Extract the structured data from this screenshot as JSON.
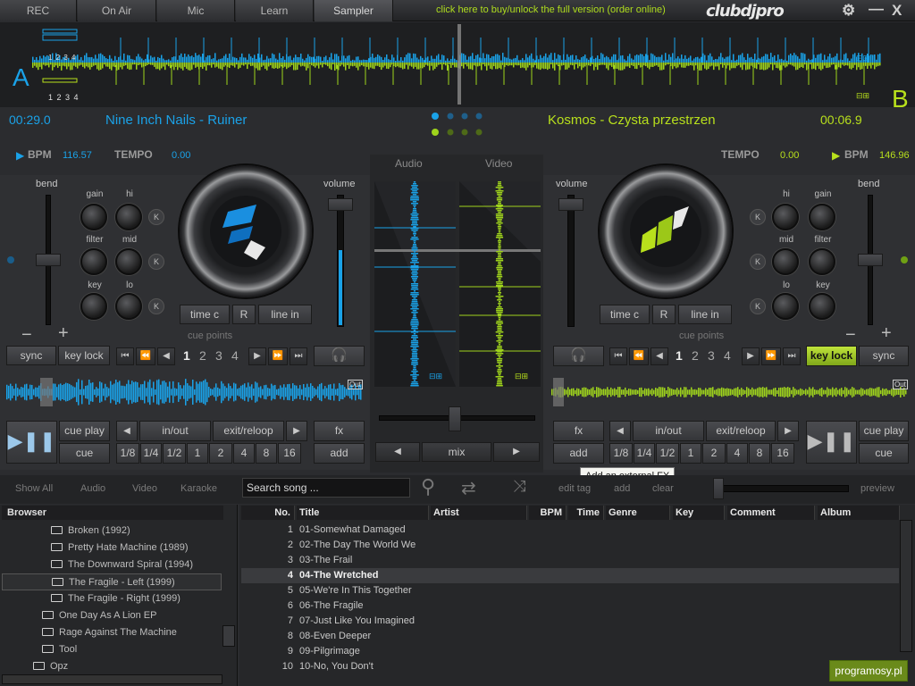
{
  "topbar": {
    "tabs": [
      "REC",
      "On Air",
      "Mic",
      "Learn",
      "Sampler"
    ],
    "buy_link": "click here to buy/unlock the full version (order online)",
    "logo": "clubdjpro",
    "gear_icon": "gear-icon",
    "minimize": "—",
    "close": "X"
  },
  "overview": {
    "deck_a_letter": "A",
    "deck_b_letter": "B",
    "beat_marks_top": "1 2 3 4",
    "beat_marks_bottom": "1 2 3 4"
  },
  "deck_a": {
    "time": "00:29.0",
    "track": "Nine Inch Nails - Ruiner",
    "bpm_label": "BPM",
    "bpm": "116.57",
    "tempo_label": "TEMPO",
    "tempo": "0.00",
    "bend_label": "bend",
    "gain": "gain",
    "hi": "hi",
    "filter": "filter",
    "mid": "mid",
    "key": "key",
    "lo": "lo",
    "k": "K",
    "volume": "volume",
    "time_c": "time c",
    "r": "R",
    "line_in": "line in",
    "cue_points": "cue points",
    "sync": "sync",
    "key_lock": "key lock",
    "cue_nums": [
      "1",
      "2",
      "3",
      "4"
    ],
    "out": "Out",
    "cue_play": "cue play",
    "cue": "cue",
    "in_out": "in/out",
    "exit_reloop": "exit/reloop",
    "fx": "fx",
    "add": "add",
    "loops": [
      "1/8",
      "1/4",
      "1/2",
      "1",
      "2",
      "4",
      "8",
      "16"
    ]
  },
  "deck_b": {
    "time": "00:06.9",
    "track": "Kosmos - Czysta przestrzen",
    "bpm_label": "BPM",
    "bpm": "146.96",
    "tempo_label": "TEMPO",
    "tempo": "0.00",
    "bend_label": "bend",
    "gain": "gain",
    "hi": "hi",
    "filter": "filter",
    "mid": "mid",
    "key": "key",
    "lo": "lo",
    "k": "K",
    "volume": "volume",
    "time_c": "time c",
    "r": "R",
    "line_in": "line in",
    "cue_points": "cue points",
    "sync": "sync",
    "key_lock": "key lock",
    "cue_nums": [
      "1",
      "2",
      "3",
      "4"
    ],
    "out": "Out",
    "cue_play": "cue play",
    "cue": "cue",
    "in_out": "in/out",
    "exit_reloop": "exit/reloop",
    "fx": "fx",
    "add": "add",
    "loops": [
      "1/8",
      "1/4",
      "1/2",
      "1",
      "2",
      "4",
      "8",
      "16"
    ]
  },
  "mixer": {
    "tab_audio": "Audio",
    "tab_video": "Video",
    "mix": "mix"
  },
  "tooltip": "Add an external FX",
  "browser_bar": {
    "tabs": [
      "Show All",
      "Audio",
      "Video",
      "Karaoke"
    ],
    "search_placeholder": "Search song ...",
    "edit_tag": "edit tag",
    "add": "add",
    "clear": "clear",
    "preview": "preview"
  },
  "tree": {
    "header": "Browser",
    "items": [
      {
        "label": "Broken (1992)"
      },
      {
        "label": "Pretty Hate Machine (1989)"
      },
      {
        "label": "The Downward Spiral (1994)"
      },
      {
        "label": "The Fragile - Left (1999)"
      },
      {
        "label": "The Fragile - Right (1999)"
      },
      {
        "label": "One Day As A Lion EP"
      },
      {
        "label": "Rage Against The Machine"
      },
      {
        "label": "Tool"
      },
      {
        "label": "Opz"
      }
    ]
  },
  "table": {
    "columns": [
      "No.",
      "Title",
      "Artist",
      "BPM",
      "Time",
      "Genre",
      "Key",
      "Comment",
      "Album"
    ],
    "rows": [
      {
        "no": "1",
        "title": "01-Somewhat Damaged"
      },
      {
        "no": "2",
        "title": "02-The Day The World We"
      },
      {
        "no": "3",
        "title": "03-The Frail"
      },
      {
        "no": "4",
        "title": "04-The Wretched"
      },
      {
        "no": "5",
        "title": "05-We're In This Together"
      },
      {
        "no": "6",
        "title": "06-The Fragile"
      },
      {
        "no": "7",
        "title": "07-Just Like You Imagined"
      },
      {
        "no": "8",
        "title": "08-Even Deeper"
      },
      {
        "no": "9",
        "title": "09-Pilgrimage"
      },
      {
        "no": "10",
        "title": "10-No, You Don't"
      }
    ]
  },
  "watermark": "programosy.pl",
  "colors": {
    "deck_a": "#1aa2e8",
    "deck_b": "#b8e01c",
    "bg": "#2b2c2f"
  }
}
